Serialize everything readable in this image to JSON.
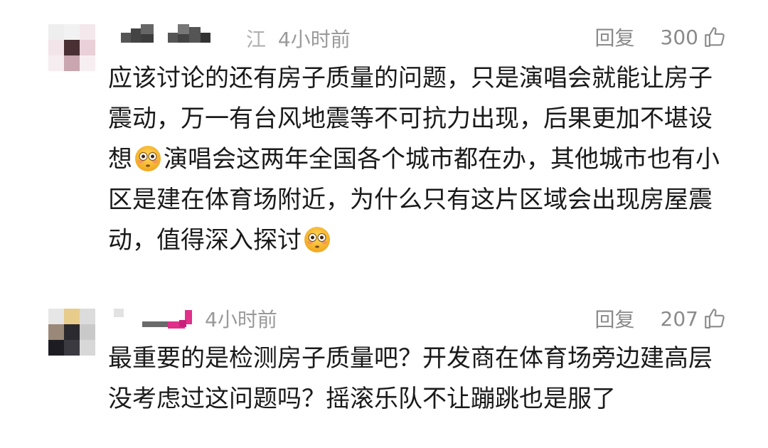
{
  "comments": [
    {
      "user_fragment": "江",
      "time": "4小时前",
      "reply_label": "回复",
      "likes": "300",
      "text_part1": "应该讨论的还有房子质量的问题，只是演唱会就能让房子震动，万一有台风地震等不可抗力出现，后果更加不堪设想",
      "text_part2": "演唱会这两年全国各个城市都在办，其他城市也有小区是建在体育场附近，为什么只有这片区域会出现房屋震动，值得深入探讨",
      "emoji": "flushed-face-emoji",
      "avatar_colors": [
        "#eeeeee",
        "#f3e4ea",
        "#4a2f33",
        "#c9a6b0",
        "#ead0d8",
        "#f6edf0"
      ]
    },
    {
      "time": "4小时前",
      "reply_label": "回复",
      "likes": "207",
      "text": "最重要的是检测房子质量吧？开发商在体育场旁边建高层没考虑过这问题吗？摇滚乐队不让蹦跳也是服了",
      "avatar_colors": [
        "#e8cc8c",
        "#c9c9c9",
        "#2b2a2e",
        "#7c6a5a",
        "#1d1c22",
        "#d8d8d8"
      ],
      "name_accent_color": "#e0308a"
    }
  ],
  "icons": {
    "like": "thumbs-up-icon",
    "emoji": "flushed-face-emoji"
  }
}
